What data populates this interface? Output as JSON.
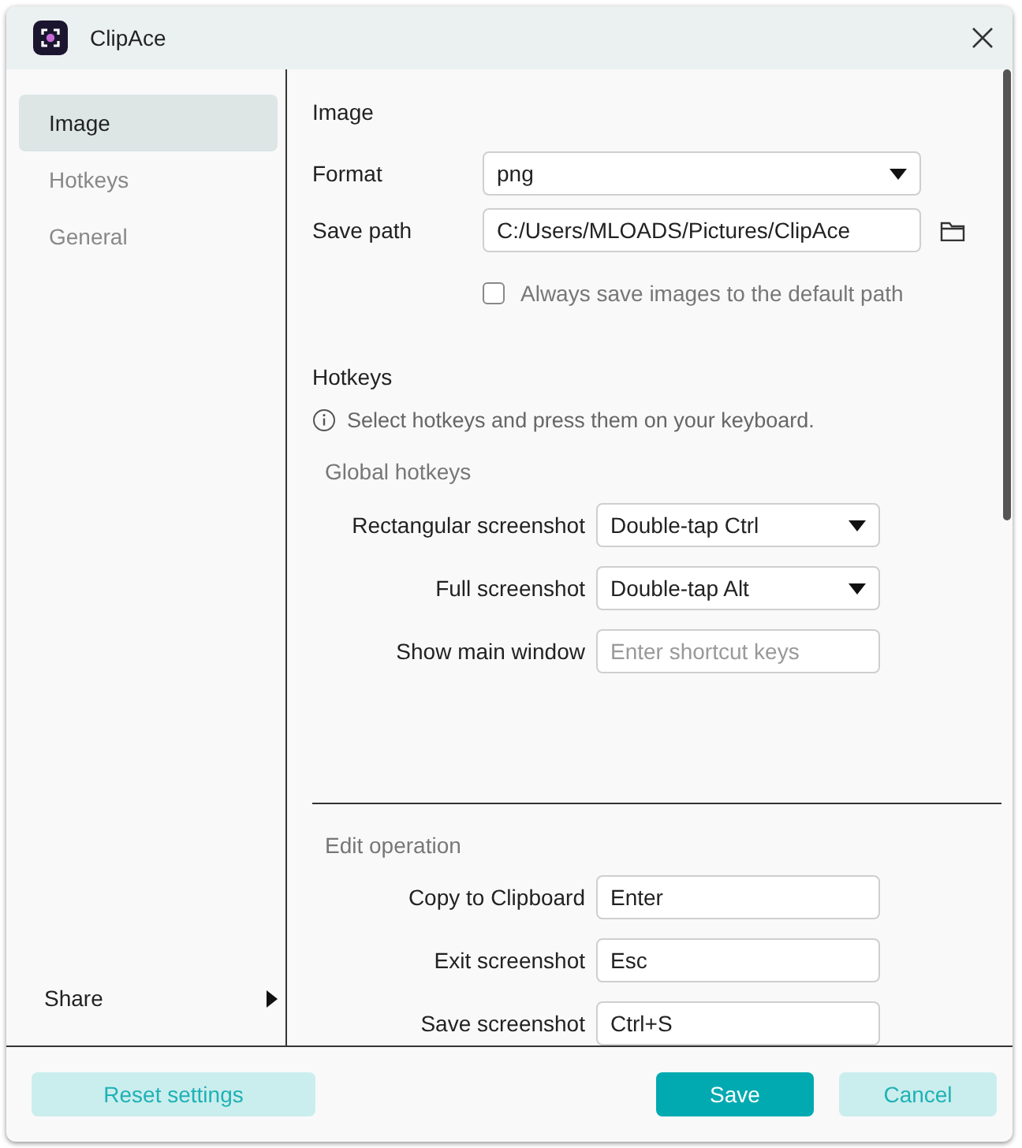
{
  "window": {
    "title": "ClipAce"
  },
  "sidebar": {
    "items": [
      {
        "label": "Image",
        "selected": true
      },
      {
        "label": "Hotkeys",
        "selected": false
      },
      {
        "label": "General",
        "selected": false
      }
    ],
    "share": {
      "label": "Share"
    }
  },
  "image_section": {
    "title": "Image",
    "fields": [
      {
        "kind": "select",
        "label": "Format",
        "value": "png"
      },
      {
        "kind": "path",
        "label": "Save path",
        "value": "C:/Users/MLOADS/Pictures/ClipAce"
      }
    ],
    "checkbox": {
      "label": "Always save images to the default path",
      "checked": false
    }
  },
  "hotkeys_section": {
    "title": "Hotkeys",
    "info": "Select hotkeys and press them on your keyboard.",
    "groups": [
      {
        "title": "Global hotkeys",
        "rows": [
          {
            "kind": "select",
            "label": "Rectangular screenshot",
            "value": "Double-tap Ctrl"
          },
          {
            "kind": "select",
            "label": "Full screenshot",
            "value": "Double-tap Alt"
          },
          {
            "kind": "input",
            "label": "Show main window",
            "placeholder": "Enter shortcut keys"
          }
        ]
      },
      {
        "title": "Edit operation",
        "rows": [
          {
            "kind": "input",
            "label": "Copy to Clipboard",
            "value": "Enter"
          },
          {
            "kind": "input",
            "label": "Exit screenshot",
            "value": "Esc"
          },
          {
            "kind": "input",
            "label": "Save screenshot",
            "value": "Ctrl+S"
          }
        ]
      }
    ]
  },
  "footer": {
    "buttons": [
      {
        "kind": "secondary",
        "label": "Reset settings"
      },
      {
        "kind": "primary",
        "label": "Save"
      },
      {
        "kind": "secondary",
        "label": "Cancel"
      }
    ]
  }
}
